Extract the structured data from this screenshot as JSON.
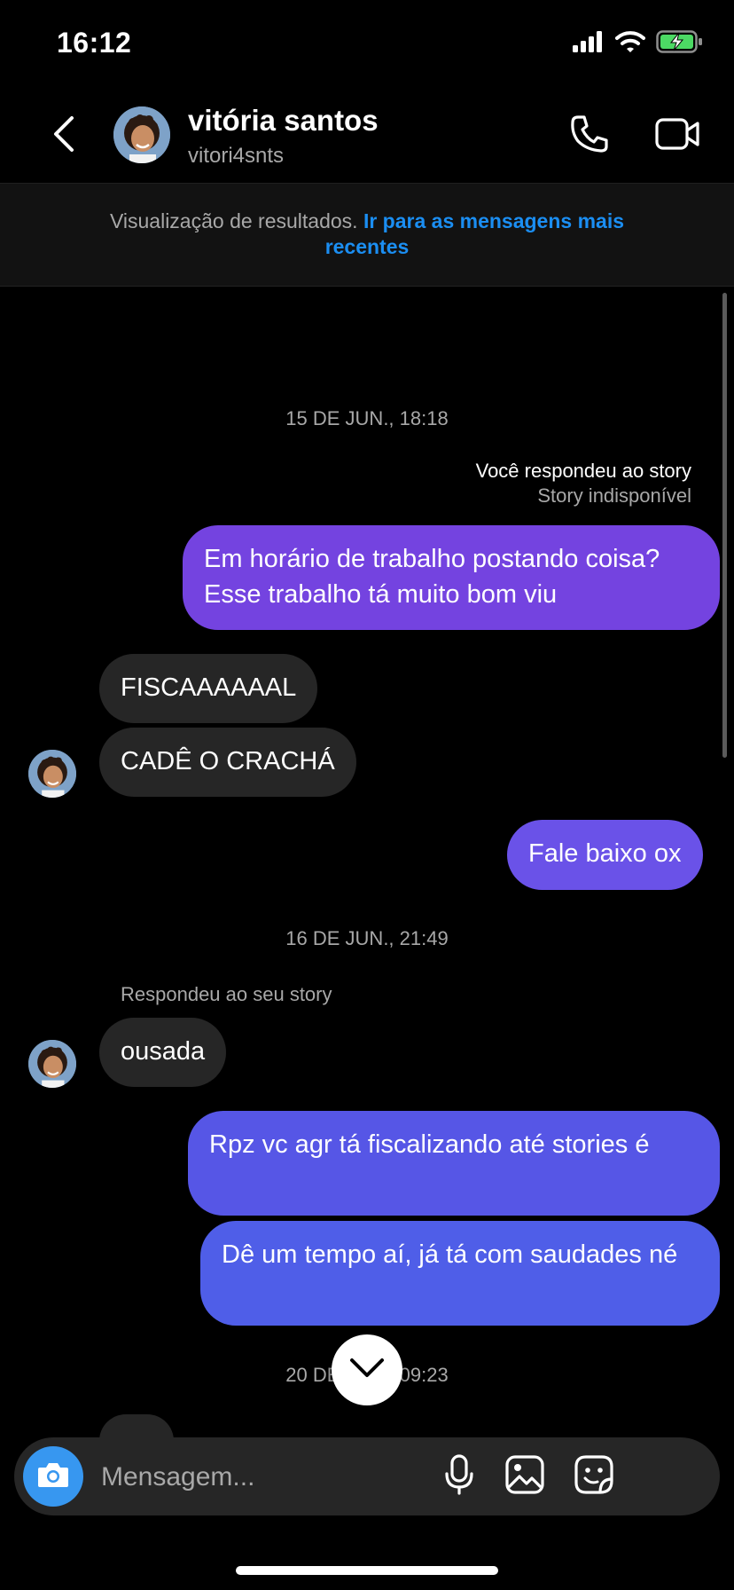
{
  "status_bar": {
    "time": "16:12"
  },
  "header": {
    "name": "vitória santos",
    "username": "vitori4snts"
  },
  "banner": {
    "text": "Visualização de resultados. ",
    "link": "Ir para as mensagens mais recentes"
  },
  "messages": {
    "ts1": "15 DE JUN., 18:18",
    "story_note_main": "Você respondeu ao story",
    "story_note_sub": "Story indisponível",
    "m1": "Em horário de trabalho postando coisa? Esse trabalho tá muito bom viu",
    "m2": "FISCAAAAAAL",
    "m3": "CADÊ O CRACHÁ",
    "m4": "Fale baixo ox",
    "ts2": "16 DE JUN., 21:49",
    "reply_label": "Respondeu ao seu story",
    "m5": "ousada",
    "m6": "Rpz vc agr tá fiscalizando até stories é",
    "m7": "Dê um tempo aí, já tá com saudades né",
    "ts3": "20 DE JUN., 09:23"
  },
  "composer": {
    "placeholder": "Mensagem..."
  },
  "colors": {
    "accent_blue": "#3797f0",
    "link_blue": "#1b8ef2",
    "out_bubble_purple": "#7443e0",
    "out_bubble_indigo": "#6a52e8",
    "out_bubble_blue": "#4f5ee8",
    "in_bubble": "#262626"
  }
}
